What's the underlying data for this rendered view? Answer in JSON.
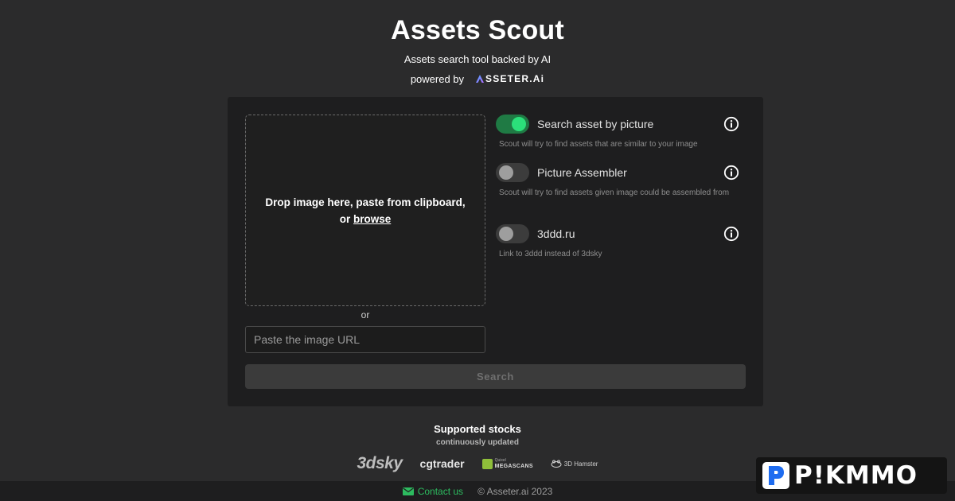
{
  "header": {
    "title": "Assets Scout",
    "subtitle": "Assets search tool backed by AI",
    "powered_by": "powered by",
    "brand": "SSETER.Ai"
  },
  "upload": {
    "drop_text": "Drop image here, paste from clipboard,",
    "or_prefix": "or",
    "browse_label": "browse",
    "or_separator": "or",
    "url_placeholder": "Paste the image URL"
  },
  "options": [
    {
      "label": "Search asset by picture",
      "description": "Scout will try to find assets that are similar to your image",
      "enabled": true
    },
    {
      "label": "Picture Assembler",
      "description": "Scout will try to find assets given image could be assembled from",
      "enabled": false
    },
    {
      "label": "3ddd.ru",
      "description": "Link to 3ddd instead of 3dsky",
      "enabled": false
    }
  ],
  "search_button": "Search",
  "stocks": {
    "title": "Supported stocks",
    "subtitle": "continuously updated",
    "logos": {
      "sky": "3dsky",
      "cgtrader": "cgtrader",
      "mega_small": "Quixel",
      "mega_big": "MEGASCANS",
      "hamster": "3D Hamster"
    }
  },
  "footer": {
    "contact": "Contact us",
    "copyright": "© Asseter.ai 2023"
  },
  "watermark": "P!KMMO",
  "colors": {
    "background": "#2b2b2c",
    "panel": "#1e1e1f",
    "accent_green": "#2be07a",
    "contact_green": "#2dbb5f"
  }
}
